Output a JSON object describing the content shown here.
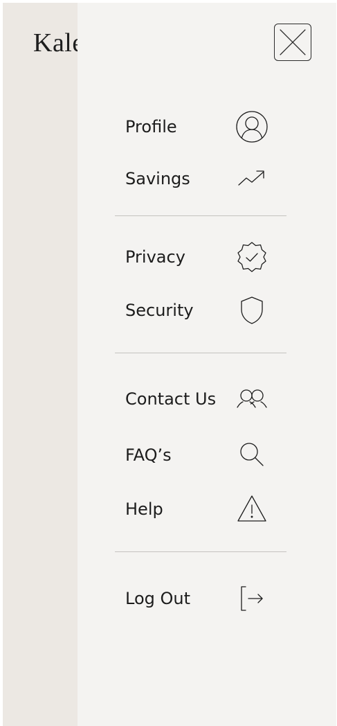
{
  "brand": {
    "name": "Kale"
  },
  "close": {
    "icon": "close-icon"
  },
  "menu": {
    "groups": [
      {
        "items": [
          {
            "label": "Profile",
            "icon": "user-circle-icon"
          },
          {
            "label": "Savings",
            "icon": "trend-up-icon"
          }
        ]
      },
      {
        "items": [
          {
            "label": "Privacy",
            "icon": "verified-badge-icon"
          },
          {
            "label": "Security",
            "icon": "shield-icon"
          }
        ]
      },
      {
        "items": [
          {
            "label": "Contact Us",
            "icon": "users-icon"
          },
          {
            "label": "FAQ’s",
            "icon": "search-icon"
          },
          {
            "label": "Help",
            "icon": "warning-icon"
          }
        ]
      },
      {
        "items": [
          {
            "label": "Log Out",
            "icon": "logout-icon"
          }
        ]
      }
    ]
  },
  "colors": {
    "panel_background": "#f4f3f1",
    "backdrop": "#ece8e3",
    "text": "#1c1c1c",
    "divider": "#c4c2bf"
  }
}
